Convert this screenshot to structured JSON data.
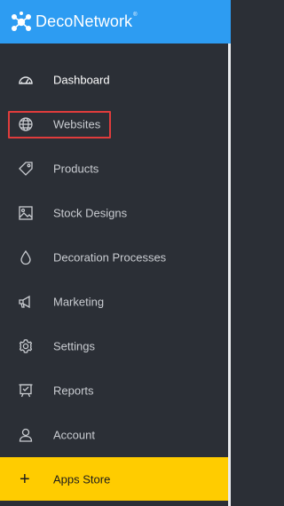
{
  "brand": {
    "name": "DecoNetwork",
    "registered": "®",
    "color": "#2d9cf2"
  },
  "sidebar": {
    "items": [
      {
        "label": "Dashboard",
        "icon": "speedometer-icon",
        "active": true
      },
      {
        "label": "Websites",
        "icon": "globe-icon",
        "highlighted": true
      },
      {
        "label": "Products",
        "icon": "tag-icon"
      },
      {
        "label": "Stock Designs",
        "icon": "image-icon"
      },
      {
        "label": "Decoration Processes",
        "icon": "drop-icon"
      },
      {
        "label": "Marketing",
        "icon": "megaphone-icon"
      },
      {
        "label": "Settings",
        "icon": "gear-icon"
      },
      {
        "label": "Reports",
        "icon": "presentation-icon"
      },
      {
        "label": "Account",
        "icon": "user-icon"
      }
    ],
    "apps_store": {
      "label": "Apps Store",
      "icon": "plus-icon",
      "color": "#ffcc00"
    }
  },
  "colors": {
    "sidebar_bg": "#2b2f36",
    "highlight": "#e03c3c"
  }
}
